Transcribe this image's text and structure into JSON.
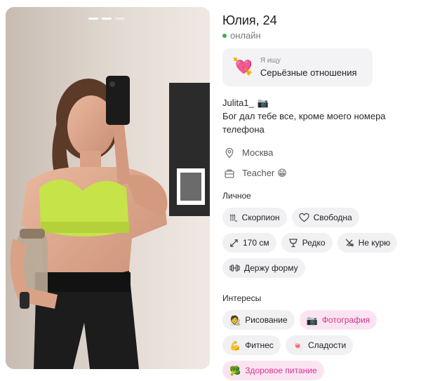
{
  "profile": {
    "name_age": "Юлия, 24",
    "status": "онлайн"
  },
  "looking_for": {
    "label": "Я ищу",
    "value": "Серьёзные отношения",
    "icon": "heart-arrow-emoji"
  },
  "bio": {
    "handle": "Julita1_",
    "handle_icon": "camera-emoji",
    "text": "Бог дал тебе все, кроме моего номера телефона"
  },
  "meta": {
    "city": "Москва",
    "job": "Teacher",
    "job_icon": "grin-emoji"
  },
  "personal": {
    "title": "Личное",
    "chips": [
      {
        "icon": "scorpio-sign-icon",
        "label": "Скорпион"
      },
      {
        "icon": "heart-outline-icon",
        "label": "Свободна"
      },
      {
        "icon": "height-arrows-icon",
        "label": "170 см"
      },
      {
        "icon": "glass-icon",
        "label": "Редко"
      },
      {
        "icon": "no-smoking-icon",
        "label": "Не курю"
      },
      {
        "icon": "dumbbell-icon",
        "label": "Держу форму"
      }
    ]
  },
  "interests": {
    "title": "Интересы",
    "chips": [
      {
        "icon": "artist-emoji",
        "label": "Рисование",
        "highlight": false
      },
      {
        "icon": "camera-emoji",
        "label": "Фотография",
        "highlight": true
      },
      {
        "icon": "flexed-biceps-emoji",
        "label": "Фитнес",
        "highlight": false
      },
      {
        "icon": "candy-emoji",
        "label": "Сладости",
        "highlight": false
      },
      {
        "icon": "broccoli-emoji",
        "label": "Здоровое питание",
        "highlight": true
      }
    ]
  },
  "colors": {
    "online_dot": "#37b24d",
    "highlight_text": "#d4338f",
    "highlight_bg": "#fbe4f1",
    "chip_bg": "#f1f1f3"
  }
}
